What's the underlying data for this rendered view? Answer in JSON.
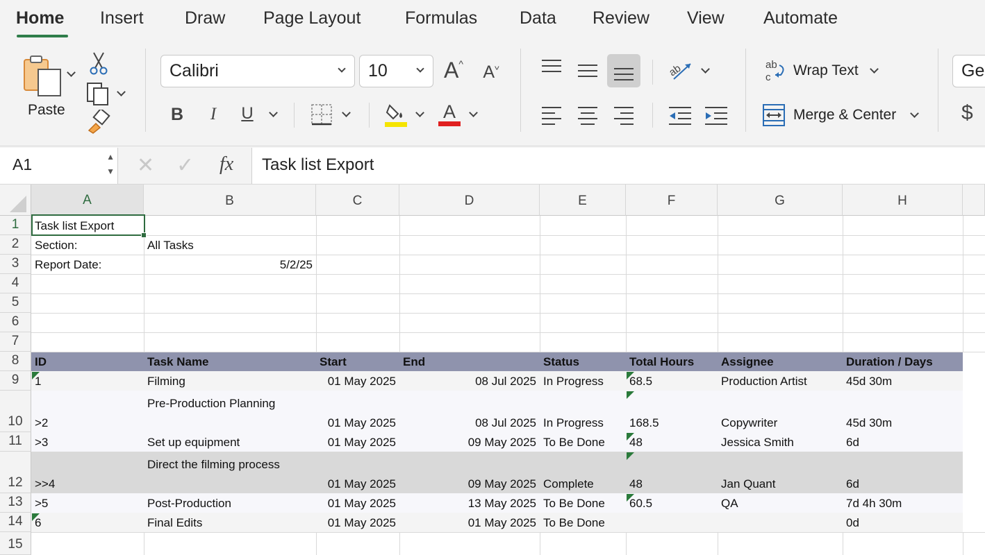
{
  "ribbon_tabs": [
    "Home",
    "Insert",
    "Draw",
    "Page Layout",
    "Formulas",
    "Data",
    "Review",
    "View",
    "Automate"
  ],
  "clipboard": {
    "paste_label": "Paste"
  },
  "font": {
    "family": "Calibri",
    "size": "10",
    "grow_label": "A",
    "shrink_label": "A",
    "bold": "B",
    "italic": "I",
    "underline": "U",
    "font_color_label": "A"
  },
  "colors": {
    "accent": "#2e6b3f",
    "header_band": "#8f93ad",
    "highlight": "#f5e400",
    "font_color": "#e02020",
    "row_grey": "#d9d9d9",
    "row_light": "#f7f7fb"
  },
  "alignment": {
    "wrap_text": "Wrap Text",
    "merge_center": "Merge & Center",
    "wrap_icon_text": "ab"
  },
  "number": {
    "format_partial": "Ger",
    "currency": "$"
  },
  "formula_bar": {
    "name_box": "A1",
    "fx": "fx",
    "content": "Task list Export"
  },
  "columns": [
    "A",
    "B",
    "C",
    "D",
    "E",
    "F",
    "G",
    "H"
  ],
  "rows": [
    "1",
    "2",
    "3",
    "4",
    "5",
    "6",
    "7",
    "8",
    "9",
    "10",
    "11",
    "12",
    "13",
    "14",
    "15"
  ],
  "meta": {
    "title": "Task list Export",
    "section_label": "Section:",
    "section_value": "All Tasks",
    "report_date_label": "Report Date:",
    "report_date_value": "5/2/25"
  },
  "table_headers": [
    "ID",
    "Task Name",
    "Start",
    "End",
    "Status",
    "Total Hours",
    "Assignee",
    "Duration / Days"
  ],
  "tasks": [
    {
      "id": "1",
      "name": "Filming",
      "start": "01 May 2025",
      "end": "08 Jul 2025",
      "status": "In Progress",
      "hours": "68.5",
      "assignee": "Production Artist",
      "duration": "45d 30m"
    },
    {
      "id": ">2",
      "name": "Pre-Production Planning",
      "start": "01 May 2025",
      "end": "08 Jul 2025",
      "status": "In Progress",
      "hours": "168.5",
      "assignee": "Copywriter",
      "duration": "45d 30m"
    },
    {
      "id": ">3",
      "name": "Set up equipment",
      "start": "01 May 2025",
      "end": "09 May 2025",
      "status": "To Be Done",
      "hours": "48",
      "assignee": "Jessica Smith",
      "duration": "6d"
    },
    {
      "id": ">>4",
      "name": "Direct the filming process",
      "start": "01 May 2025",
      "end": "09 May 2025",
      "status": "Complete",
      "hours": "48",
      "assignee": "Jan Quant",
      "duration": "6d"
    },
    {
      "id": ">5",
      "name": "Post-Production",
      "start": "01 May 2025",
      "end": "13 May 2025",
      "status": "To Be Done",
      "hours": "60.5",
      "assignee": "QA",
      "duration": "7d 4h 30m"
    },
    {
      "id": "6",
      "name": "Final Edits",
      "start": "01 May 2025",
      "end": "01 May 2025",
      "status": "To Be Done",
      "hours": "",
      "assignee": "",
      "duration": "0d"
    }
  ]
}
